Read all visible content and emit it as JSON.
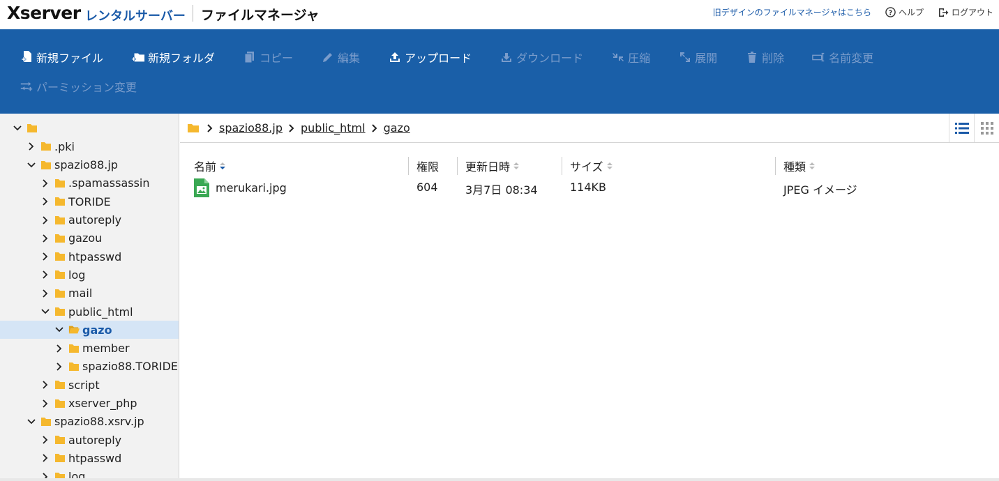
{
  "header": {
    "logo": "Xserver",
    "logo_sub": "レンタルサーバー",
    "app_title": "ファイルマネージャ",
    "old_design_link": "旧デザインのファイルマネージャはこちら",
    "help": "ヘルプ",
    "logout": "ログアウト"
  },
  "toolbar": {
    "new_file": "新規ファイル",
    "new_folder": "新規フォルダ",
    "copy": "コピー",
    "edit": "編集",
    "upload": "アップロード",
    "download": "ダウンロード",
    "compress": "圧縮",
    "extract": "展開",
    "delete": "削除",
    "rename": "名前変更",
    "permission": "パーミッション変更"
  },
  "tree": {
    "items": [
      {
        "label": "",
        "level": 0,
        "expanded": true
      },
      {
        "label": ".pki",
        "level": 1,
        "expanded": false
      },
      {
        "label": "spazio88.jp",
        "level": 1,
        "expanded": true
      },
      {
        "label": ".spamassassin",
        "level": 2,
        "expanded": false
      },
      {
        "label": "TORIDE",
        "level": 2,
        "expanded": false
      },
      {
        "label": "autoreply",
        "level": 2,
        "expanded": false
      },
      {
        "label": "gazou",
        "level": 2,
        "expanded": false
      },
      {
        "label": "htpasswd",
        "level": 2,
        "expanded": false
      },
      {
        "label": "log",
        "level": 2,
        "expanded": false
      },
      {
        "label": "mail",
        "level": 2,
        "expanded": false
      },
      {
        "label": "public_html",
        "level": 2,
        "expanded": true
      },
      {
        "label": "gazo",
        "level": 3,
        "expanded": true,
        "selected": true
      },
      {
        "label": "member",
        "level": 3,
        "expanded": false
      },
      {
        "label": "spazio88.TORIDE",
        "level": 3,
        "expanded": false
      },
      {
        "label": "script",
        "level": 2,
        "expanded": false
      },
      {
        "label": "xserver_php",
        "level": 2,
        "expanded": false
      },
      {
        "label": "spazio88.xsrv.jp",
        "level": 1,
        "expanded": true
      },
      {
        "label": "autoreply",
        "level": 2,
        "expanded": false
      },
      {
        "label": "htpasswd",
        "level": 2,
        "expanded": false
      },
      {
        "label": "log",
        "level": 2,
        "expanded": false
      }
    ]
  },
  "breadcrumb": [
    "spazio88.jp",
    "public_html",
    "gazo"
  ],
  "columns": {
    "name": "名前",
    "permission": "権限",
    "modified": "更新日時",
    "size": "サイズ",
    "type": "種類"
  },
  "files": [
    {
      "name": "merukari.jpg",
      "permission": "604",
      "modified": "3月7日 08:34",
      "size": "114KB",
      "type": "JPEG イメージ"
    }
  ],
  "colors": {
    "toolbar_bg": "#1a5fa8",
    "accent": "#1a5aa8",
    "folder": "#f5b82e",
    "selected_bg": "#d5e5f6"
  }
}
